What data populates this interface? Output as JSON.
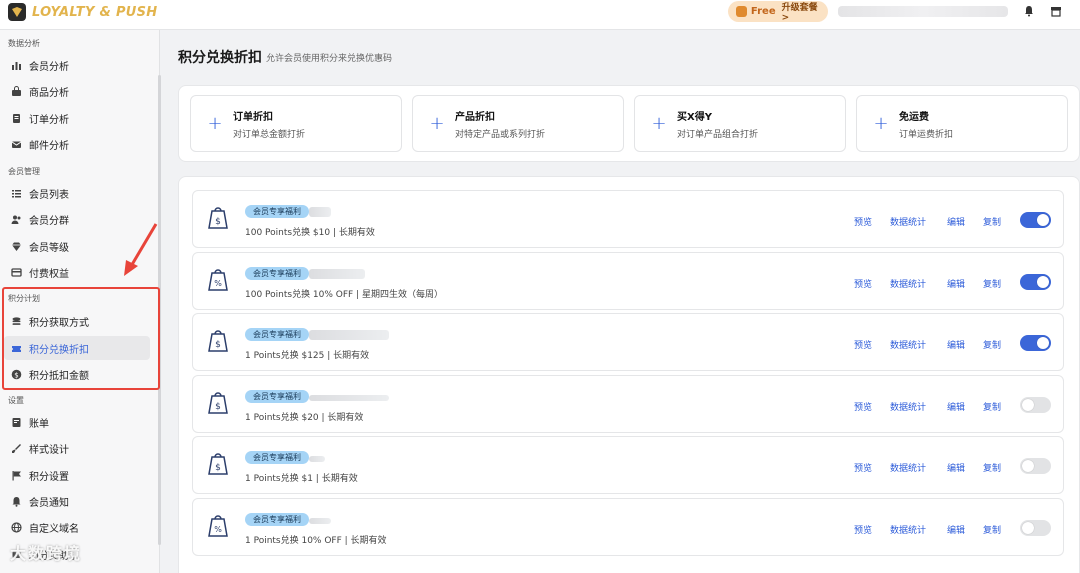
{
  "app": {
    "logo_text": "LOYALTY & PUSH"
  },
  "topbar": {
    "free_label": "Free",
    "upgrade_label": "升级套餐 >"
  },
  "sidebar": {
    "sections": [
      {
        "title": "数据分析",
        "items": [
          {
            "label": "会员分析",
            "icon": "bar-chart-icon"
          },
          {
            "label": "商品分析",
            "icon": "bag-icon"
          },
          {
            "label": "订单分析",
            "icon": "document-icon"
          },
          {
            "label": "邮件分析",
            "icon": "mail-icon"
          }
        ]
      },
      {
        "title": "会员管理",
        "items": [
          {
            "label": "会员列表",
            "icon": "list-icon"
          },
          {
            "label": "会员分群",
            "icon": "users-icon"
          },
          {
            "label": "会员等级",
            "icon": "diamond-icon"
          },
          {
            "label": "付费权益",
            "icon": "card-icon"
          }
        ]
      },
      {
        "title": "积分计划",
        "items": [
          {
            "label": "积分获取方式",
            "icon": "coins-icon"
          },
          {
            "label": "积分兑换折扣",
            "icon": "ticket-icon",
            "active": true
          },
          {
            "label": "积分抵扣金额",
            "icon": "dollar-icon"
          }
        ]
      },
      {
        "title": "设置",
        "items": [
          {
            "label": "账单",
            "icon": "bill-icon"
          },
          {
            "label": "样式设计",
            "icon": "brush-icon"
          },
          {
            "label": "积分设置",
            "icon": "flag-icon"
          },
          {
            "label": "会员通知",
            "icon": "bell-icon"
          },
          {
            "label": "自定义域名",
            "icon": "globe-icon"
          },
          {
            "label": "AI分类助手",
            "icon": "ai-icon"
          }
        ]
      }
    ],
    "watermark": "大数跨境"
  },
  "main": {
    "title": "积分兑换折扣",
    "description": "允许会员使用积分来兑换优惠码",
    "types": [
      {
        "title": "订单折扣",
        "subtitle": "对订单总金额打折"
      },
      {
        "title": "产品折扣",
        "subtitle": "对特定产品或系列打折"
      },
      {
        "title": "买X得Y",
        "subtitle": "对订单产品组合打折"
      },
      {
        "title": "免运费",
        "subtitle": "订单运费折扣"
      }
    ],
    "actions": {
      "preview": "预览",
      "stats": "数据统计",
      "edit": "编辑",
      "copy": "复制"
    },
    "rows": [
      {
        "badge": "会员专享福利",
        "desc": "100 Points兑换 $10 | 长期有效",
        "icon": "dollar-tag-icon",
        "enabled": true
      },
      {
        "badge": "会员专享福利",
        "desc": "100 Points兑换 10% OFF | 星期四生效（每周）",
        "icon": "percent-tag-icon",
        "enabled": true
      },
      {
        "badge": "会员专享福利",
        "desc": "1 Points兑换 $125 | 长期有效",
        "icon": "dollar-tag-icon",
        "enabled": true
      },
      {
        "badge": "会员专享福利",
        "desc": "1 Points兑换 $20 | 长期有效",
        "icon": "dollar-tag-icon",
        "enabled": false
      },
      {
        "badge": "会员专享福利",
        "desc": "1 Points兑换 $1 | 长期有效",
        "icon": "dollar-tag-icon",
        "enabled": false
      },
      {
        "badge": "会员专享福利",
        "desc": "1 Points兑换 10% OFF | 长期有效",
        "icon": "percent-tag-icon",
        "enabled": false
      }
    ]
  },
  "colors": {
    "accent": "#3b66d8",
    "link": "#2c5bd9",
    "badge": "#a5d4f6",
    "highlight": "#e8443a",
    "logo": "#e2b44d"
  }
}
